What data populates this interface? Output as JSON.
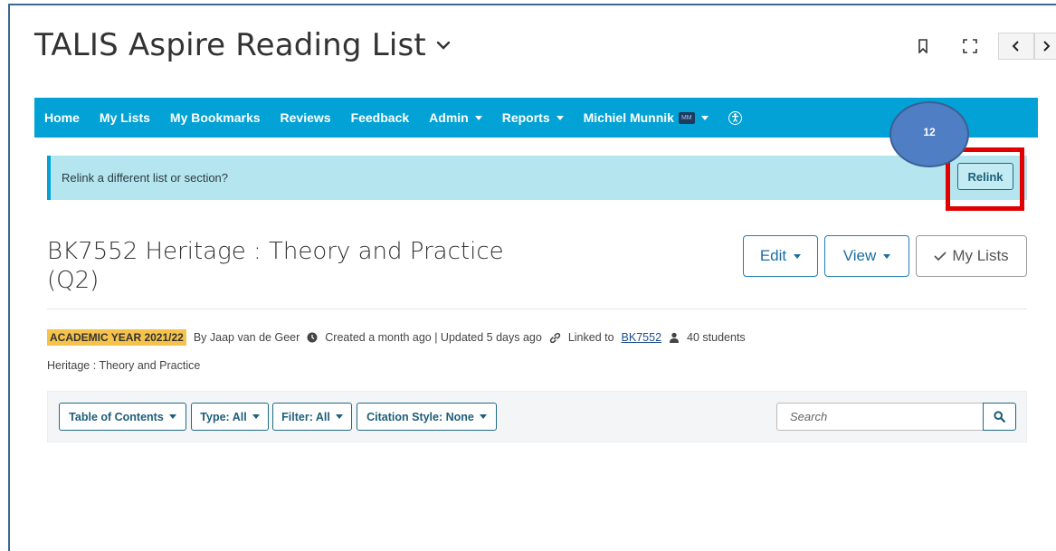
{
  "app": {
    "title": "TALIS Aspire Reading List"
  },
  "icons": {
    "title_dropdown": "chevron-down-icon",
    "bookmark": "bookmark-icon",
    "fullscreen": "fullscreen-icon",
    "prev": "chevron-left-icon",
    "next": "chevron-right-icon",
    "clock": "clock-icon",
    "link": "link-icon",
    "user": "user-icon",
    "search": "search-icon",
    "check": "check-icon",
    "accessibility": "accessibility-icon"
  },
  "colors": {
    "navbar": "#02a2d6",
    "alert_bg": "#b5e5ee",
    "badge": "#f5c24c",
    "annotation_box": "#e00000",
    "step_circle": "#4f7ec4"
  },
  "nav": {
    "home": "Home",
    "my_lists": "My Lists",
    "my_bookmarks": "My Bookmarks",
    "reviews": "Reviews",
    "feedback": "Feedback",
    "admin": "Admin",
    "reports": "Reports",
    "user_name": "Michiel Munnik",
    "user_initials": "MM"
  },
  "alert": {
    "text": "Relink a different list or section?",
    "button": "Relink"
  },
  "annotation": {
    "step": "12"
  },
  "list": {
    "title": "BK7552 Heritage : Theory and Practice (Q2)",
    "edit": "Edit",
    "view": "View",
    "my_lists": "My Lists",
    "academic_year": "ACADEMIC YEAR 2021/22",
    "author": "By Jaap van de Geer",
    "created_updated": "Created a month ago | Updated 5 days ago",
    "linked_prefix": "Linked to",
    "linked_code": "BK7552",
    "students": "40 students",
    "subtitle": "Heritage : Theory and Practice"
  },
  "toolbar": {
    "table_of_contents": "Table of Contents",
    "type": "Type: All",
    "filter": "Filter: All",
    "citation_style": "Citation Style: None",
    "search_placeholder": "Search"
  }
}
